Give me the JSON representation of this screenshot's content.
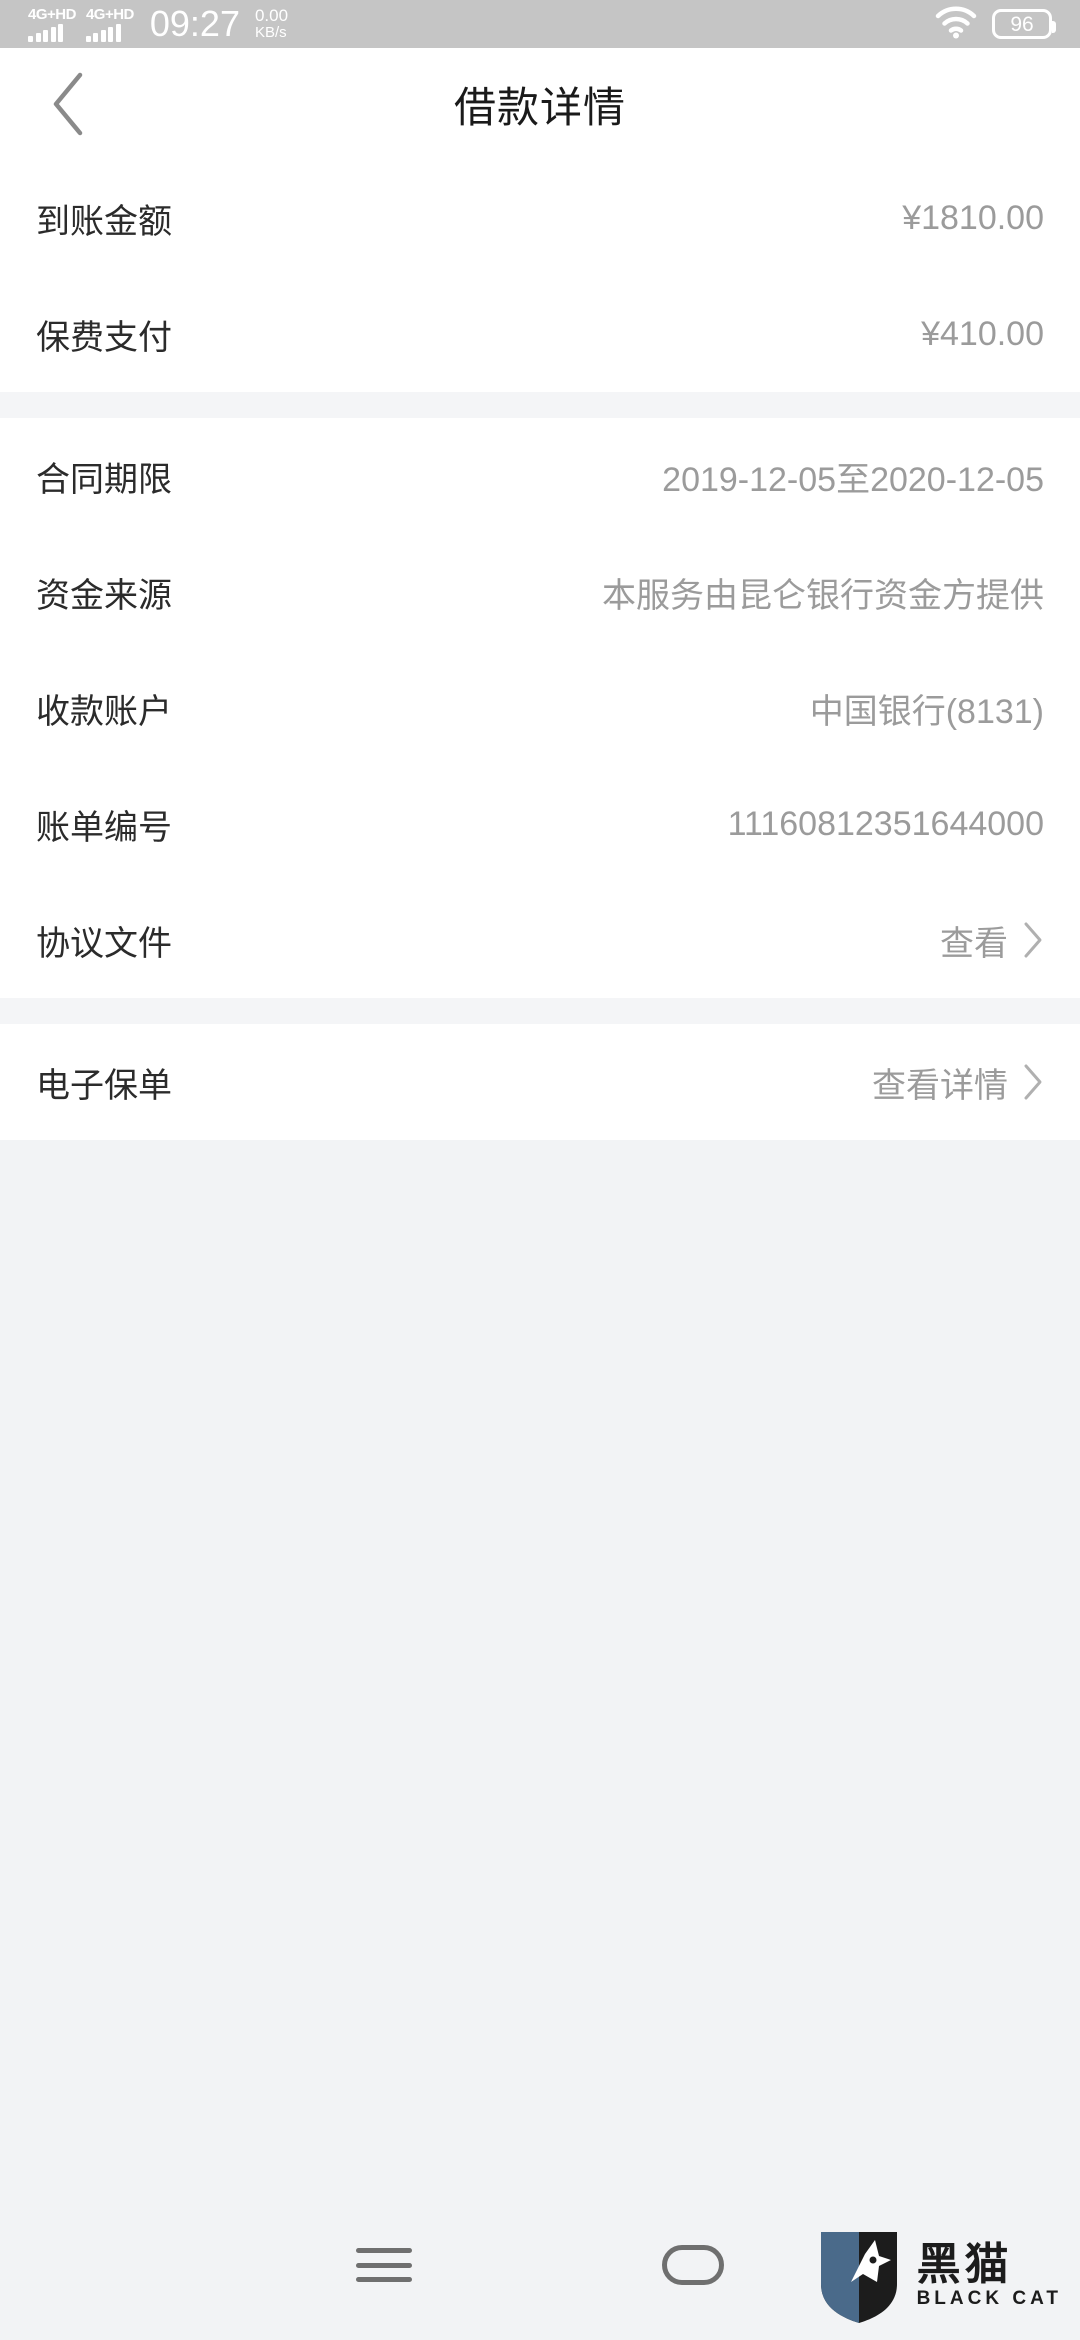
{
  "statusbar": {
    "sim1_network": "4G+HD",
    "sim2_network": "4G+HD",
    "time": "09:27",
    "netspeed_value": "0.00",
    "netspeed_unit": "KB/s",
    "wifi_icon": "wifi-icon",
    "battery_level": "96"
  },
  "header": {
    "back_icon": "chevron-left-icon",
    "title": "借款详情"
  },
  "sections": [
    {
      "rows": [
        {
          "label": "到账金额",
          "value": "¥1810.00",
          "chevron": false
        },
        {
          "label": "保费支付",
          "value": "¥410.00",
          "chevron": false
        }
      ]
    },
    {
      "rows": [
        {
          "label": "合同期限",
          "value": "2019-12-05至2020-12-05",
          "chevron": false
        },
        {
          "label": "资金来源",
          "value": "本服务由昆仑银行资金方提供",
          "chevron": false
        },
        {
          "label": "收款账户",
          "value": "中国银行(8131)",
          "chevron": false
        },
        {
          "label": "账单编号",
          "value": "11160812351644000",
          "chevron": false
        },
        {
          "label": "协议文件",
          "value": "查看",
          "chevron": true
        }
      ]
    },
    {
      "rows": [
        {
          "label": "电子保单",
          "value": "查看详情",
          "chevron": true
        }
      ]
    }
  ],
  "navbar": {
    "menu_icon": "menu-icon",
    "home_icon": "home-pill-icon"
  },
  "watermark": {
    "logo_icon": "black-cat-shield-icon",
    "name_cn": "黑猫",
    "name_en": "BLACK CAT"
  },
  "colors": {
    "statusbar_bg": "#c5c5c5",
    "card_bg": "#ffffff",
    "page_bg": "#f2f3f5",
    "label_text": "#2b2b2b",
    "value_text": "#9b9b9b"
  }
}
